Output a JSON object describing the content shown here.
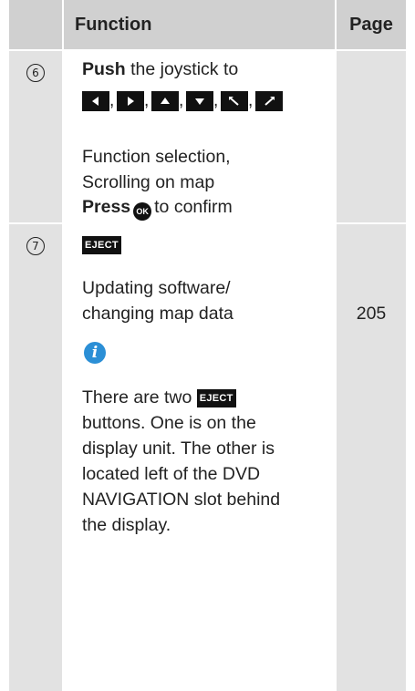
{
  "header": {
    "function_label": "Function",
    "page_label": "Page"
  },
  "rows": [
    {
      "number": "6",
      "push_bold": "Push",
      "push_rest": " the joystick to",
      "arrow_keys": [
        "left-arrow",
        "right-arrow",
        "up-arrow",
        "down-arrow",
        "diagonal-up-left-arrow",
        "diagonal-up-right-arrow"
      ],
      "comma": ",",
      "desc_line1": "Function selection,",
      "desc_line2": "Scrolling on map",
      "press_bold": "Press",
      "ok_label": "OK",
      "press_rest": "to confirm",
      "page": ""
    },
    {
      "number": "7",
      "eject_label": "EJECT",
      "desc_line1": "Updating software/",
      "desc_line2": "changing map data",
      "page": "205",
      "info_icon": "i",
      "note_line1_a": "There are two",
      "note_line2": "buttons. One is on the",
      "note_line3": "display unit. The other is",
      "note_line4": "located left of the DVD",
      "note_line5": "NAVIGATION slot behind",
      "note_line6": "the display."
    }
  ],
  "colors": {
    "column_gray": "#e2e2e2",
    "header_gray": "#d0d0d0",
    "info_blue": "#2b8fd6",
    "key_black": "#111111"
  }
}
